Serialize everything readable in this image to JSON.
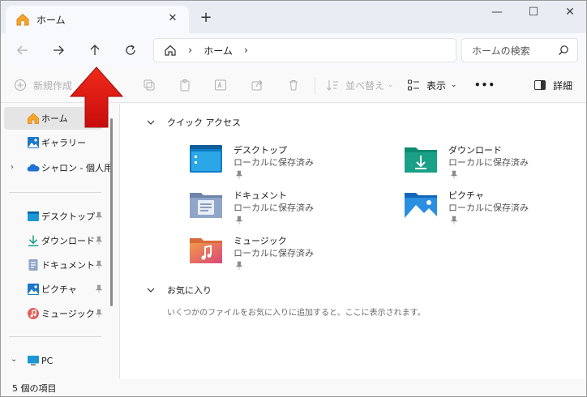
{
  "tab": {
    "title": "ホーム",
    "close_glyph": "✕",
    "new_glyph": "+"
  },
  "window": {
    "minimize": "—",
    "maximize": "☐",
    "close": "✕"
  },
  "address": {
    "crumb": "ホーム",
    "sep": "›"
  },
  "search": {
    "placeholder": "ホームの検索"
  },
  "toolbar": {
    "new_label": "新規作成",
    "sort_label": "並べ替え",
    "view_label": "表示",
    "more_glyph": "•••",
    "details_label": "詳細"
  },
  "sidebar": {
    "home": "ホーム",
    "gallery": "ギャラリー",
    "onedrive": "シャロン - 個人用",
    "desktop": "デスクトップ",
    "downloads": "ダウンロード",
    "documents": "ドキュメント",
    "pictures": "ピクチャ",
    "music": "ミュージック",
    "pc": "PC"
  },
  "quick_access": {
    "header": "クイック アクセス",
    "items": [
      {
        "name": "デスクトップ",
        "sub": "ローカルに保存済み",
        "icon": "desktop-folder-icon"
      },
      {
        "name": "ダウンロード",
        "sub": "ローカルに保存済み",
        "icon": "downloads-folder-icon"
      },
      {
        "name": "ドキュメント",
        "sub": "ローカルに保存済み",
        "icon": "documents-folder-icon"
      },
      {
        "name": "ピクチャ",
        "sub": "ローカルに保存済み",
        "icon": "pictures-folder-icon"
      },
      {
        "name": "ミュージック",
        "sub": "ローカルに保存済み",
        "icon": "music-folder-icon"
      }
    ]
  },
  "favorites": {
    "header": "お気に入り",
    "empty": "いくつかのファイルをお気に入りに追加すると、ここに表示されます。"
  },
  "status": {
    "count": "5 個の項目"
  },
  "colors": {
    "accent": "#0067c0",
    "arrow": "#e01010",
    "folder_blue": "#2a9bd8",
    "folder_green": "#1aa087"
  }
}
